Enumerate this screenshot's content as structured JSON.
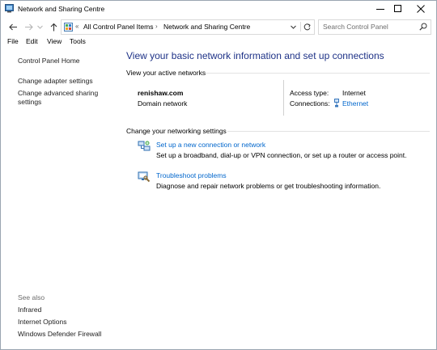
{
  "window": {
    "title": "Network and Sharing Centre"
  },
  "address_bar": {
    "overflow": "«",
    "segments": [
      "All Control Panel Items",
      "Network and Sharing Centre"
    ],
    "search_placeholder": "Search Control Panel"
  },
  "menu": [
    "File",
    "Edit",
    "View",
    "Tools"
  ],
  "sidebar": {
    "items": [
      "Control Panel Home",
      "Change adapter settings",
      "Change advanced sharing settings"
    ],
    "see_also_heading": "See also",
    "see_also": [
      "Infrared",
      "Internet Options",
      "Windows Defender Firewall"
    ]
  },
  "main": {
    "title": "View your basic network information and set up connections",
    "active_networks_label": "View your active networks",
    "network": {
      "name": "renishaw.com",
      "type": "Domain network",
      "access_type_label": "Access type:",
      "access_type_value": "Internet",
      "connections_label": "Connections:",
      "connection_value": "Ethernet"
    },
    "change_settings_label": "Change your networking settings",
    "tasks": [
      {
        "link": "Set up a new connection or network",
        "description": "Set up a broadband, dial-up or VPN connection, or set up a router or access point.",
        "icon": "network-setup-icon"
      },
      {
        "link": "Troubleshoot problems",
        "description": "Diagnose and repair network problems or get troubleshooting information.",
        "icon": "troubleshoot-icon"
      }
    ]
  },
  "colors": {
    "title_blue": "#1e3287",
    "link_blue": "#0066cc"
  }
}
